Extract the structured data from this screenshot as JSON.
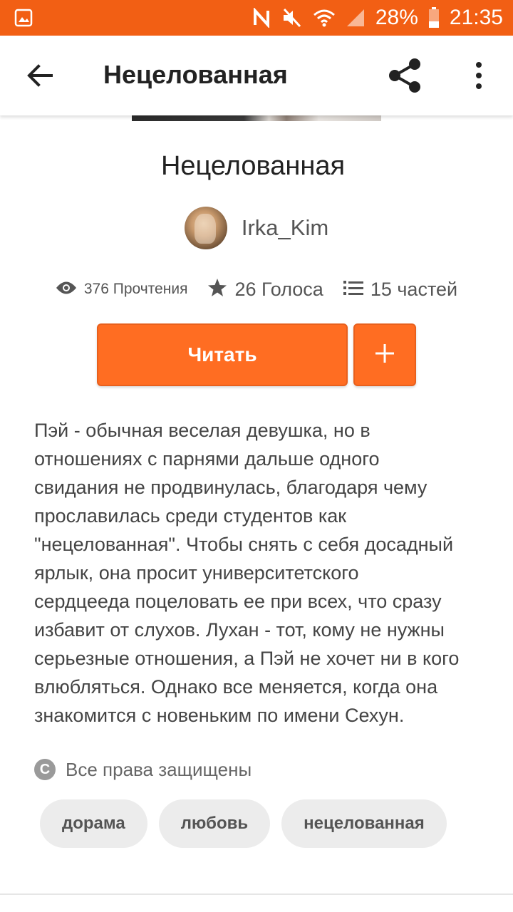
{
  "status_bar": {
    "battery": "28%",
    "time": "21:35",
    "icons": [
      "image-icon",
      "nfc-icon",
      "mute-icon",
      "wifi-icon",
      "signal-icon",
      "battery-icon"
    ]
  },
  "app_bar": {
    "title": "Нецелованная",
    "icons": [
      "back-arrow-icon",
      "share-icon",
      "more-vert-icon"
    ]
  },
  "story": {
    "title": "Нецелованная",
    "author": "Irka_Kim",
    "reads": "376 Прочтения",
    "votes": "26 Голоса",
    "parts": "15 частей",
    "read_button": "Читать",
    "add_button": "+",
    "description": "Пэй - обычная веселая девушка, но в\nотношениях с парнями дальше одного\nсвидания не продвинулась, благодаря чему\nпрославилась среди студентов как\n\"нецелованная\". Чтобы снять с себя досадный\nярлык, она просит университетского\nсердцееда поцеловать ее при всех, что сразу\nизбавит от слухов. Лухан - тот, кому не нужны\nсерьезные отношения, а Пэй не хочет ни в кого\nвлюбляться. Однако все меняется, когда она\nзнакомится с новеньким по имени Сехун.",
    "copyright": "Все права защищены",
    "tags": [
      "дорама",
      "любовь",
      "нецелованная"
    ]
  },
  "colors": {
    "status_bar": "#f25f14",
    "accent": "#ff6d22",
    "tag_bg": "#ececec"
  }
}
